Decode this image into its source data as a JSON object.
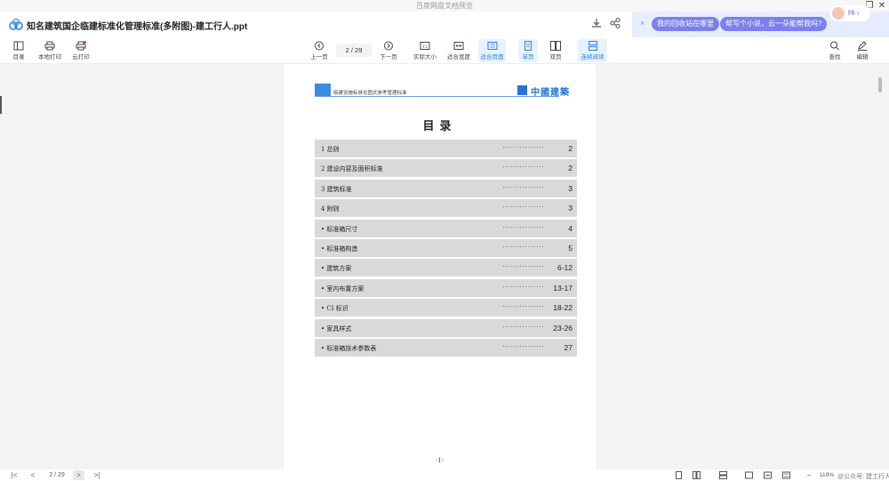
{
  "window": {
    "title": "百度网盘文档预览"
  },
  "header": {
    "doc_title": "知名建筑国企临建标准化管理标准(多附图)-建工行人.ppt"
  },
  "banner": {
    "close": "×",
    "pill1": "我的回收站在哪里",
    "pill2": "帮写个小说，云一朵能帮我吗?",
    "hi": "Hi ›"
  },
  "toolbar": {
    "outline": "目录",
    "local_print": "本地打印",
    "cloud_print": "云打印",
    "prev": "上一页",
    "page": "2 / 29",
    "next": "下一页",
    "actual": "实际大小",
    "fit_width": "适合宽度",
    "fit_page": "适合页面",
    "single": "单页",
    "double": "双页",
    "continuous": "连续阅读",
    "find": "查找",
    "edit": "编辑"
  },
  "doc": {
    "header_text": "临建设施标准化图式参考管理标准",
    "brand": "中國建築",
    "toc_title": "目录",
    "footer": "-1-",
    "toc": [
      {
        "label": "1  总则",
        "dots": "···············",
        "page": "2"
      },
      {
        "label": "2  建设内容及面积标准",
        "dots": "···············",
        "page": "2"
      },
      {
        "label": "3  建筑标准",
        "dots": "···············",
        "page": "3"
      },
      {
        "label": "4  附则",
        "dots": "···············",
        "page": "3"
      },
      {
        "label": "  • 标准箱尺寸",
        "dots": "···············",
        "page": "4"
      },
      {
        "label": "  • 标准箱构造",
        "dots": "···············",
        "page": "5"
      },
      {
        "label": "  • 建筑方案",
        "dots": "···············",
        "page": "6-12"
      },
      {
        "label": "  • 室内布置方案",
        "dots": "···············",
        "page": "13-17"
      },
      {
        "label": "  • CI 标识",
        "dots": "···············",
        "page": "18-22"
      },
      {
        "label": "  • 家具样式",
        "dots": "···············",
        "page": "23-26"
      },
      {
        "label": "  • 标准箱技术参数表",
        "dots": "···············",
        "page": "27"
      }
    ]
  },
  "status": {
    "first": "|<",
    "prev": "<",
    "page": "2 / 29",
    "next": ">",
    "last": ">|",
    "zoom_minus": "−",
    "zoom": "119%",
    "watermark": "@公众号: 建工行人"
  }
}
